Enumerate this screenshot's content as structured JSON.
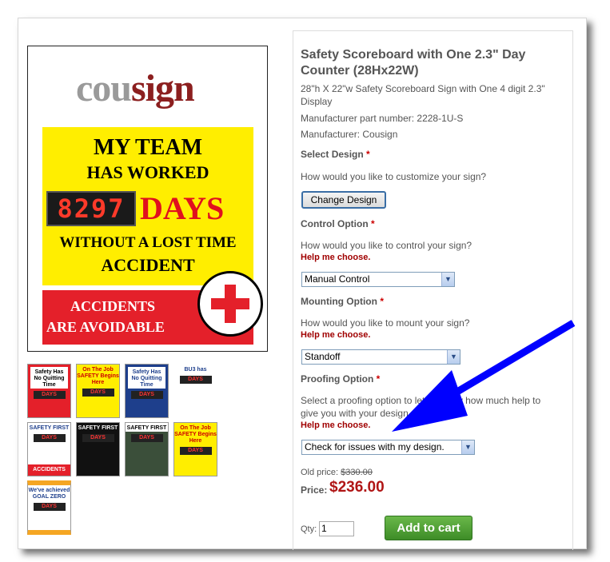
{
  "product": {
    "title": "Safety Scoreboard with One 2.3\" Day Counter (28Hx22W)",
    "description": "28\"h X 22\"w Safety Scoreboard Sign with One 4 digit 2.3\" Display",
    "part_number": "Manufacturer part number: 2228-1U-S",
    "manufacturer": "Manufacturer: Cousign"
  },
  "main_image": {
    "logo_part1": "cou",
    "logo_part2": "sign",
    "line1": "MY TEAM",
    "line2": "HAS WORKED",
    "counter": "8297",
    "days": "DAYS",
    "line3": "WITHOUT A LOST TIME",
    "line4": "ACCIDENT",
    "red_line1": "ACCIDENTS",
    "red_line2": "ARE AVOIDABLE"
  },
  "thumbnails": [
    {
      "top": "Safety Has No Quitting Time",
      "bottom": ""
    },
    {
      "top": "On The Job SAFETY Begins Here",
      "bottom": ""
    },
    {
      "top": "Safety Has No Quitting Time",
      "bottom": ""
    },
    {
      "top": "BU3 has",
      "bottom": ""
    },
    {
      "top": "SAFETY FIRST",
      "bottom": "ACCIDENTS ARE AVOIDABLE"
    },
    {
      "top": "SAFETY FIRST",
      "bottom": ""
    },
    {
      "top": "SAFETY FIRST",
      "bottom": ""
    },
    {
      "top": "On The Job SAFETY Begins Here",
      "bottom": ""
    },
    {
      "top": "We've achieved GOAL ZERO",
      "bottom": ""
    }
  ],
  "select_design": {
    "label": "Select Design",
    "required": "*",
    "question": "How would you like to customize your sign?",
    "button": "Change Design"
  },
  "control_option": {
    "label": "Control Option",
    "required": "*",
    "question": "How would you like to control your sign?",
    "help": "Help me choose.",
    "selected": "Manual Control"
  },
  "mounting_option": {
    "label": "Mounting Option",
    "required": "*",
    "question": "How would you like to mount your sign?",
    "help": "Help me choose.",
    "selected": "Standoff"
  },
  "proofing_option": {
    "label": "Proofing Option",
    "required": "*",
    "question_line1": "Select a proofing option to let us know how much help to",
    "question_line2": "give you with your design.",
    "help": "Help me choose.",
    "selected": "Check for issues with my design."
  },
  "pricing": {
    "old_label": "Old price:",
    "old_price": "$330.00",
    "price_label": "Price:",
    "price": "$236.00"
  },
  "cart": {
    "qty_label": "Qty:",
    "qty_value": "1",
    "add_to_cart": "Add to cart"
  },
  "colors": {
    "arrow": "#0000ff",
    "cart_button": "#4a9c30",
    "price": "#b01515",
    "help_link": "#a00000"
  }
}
